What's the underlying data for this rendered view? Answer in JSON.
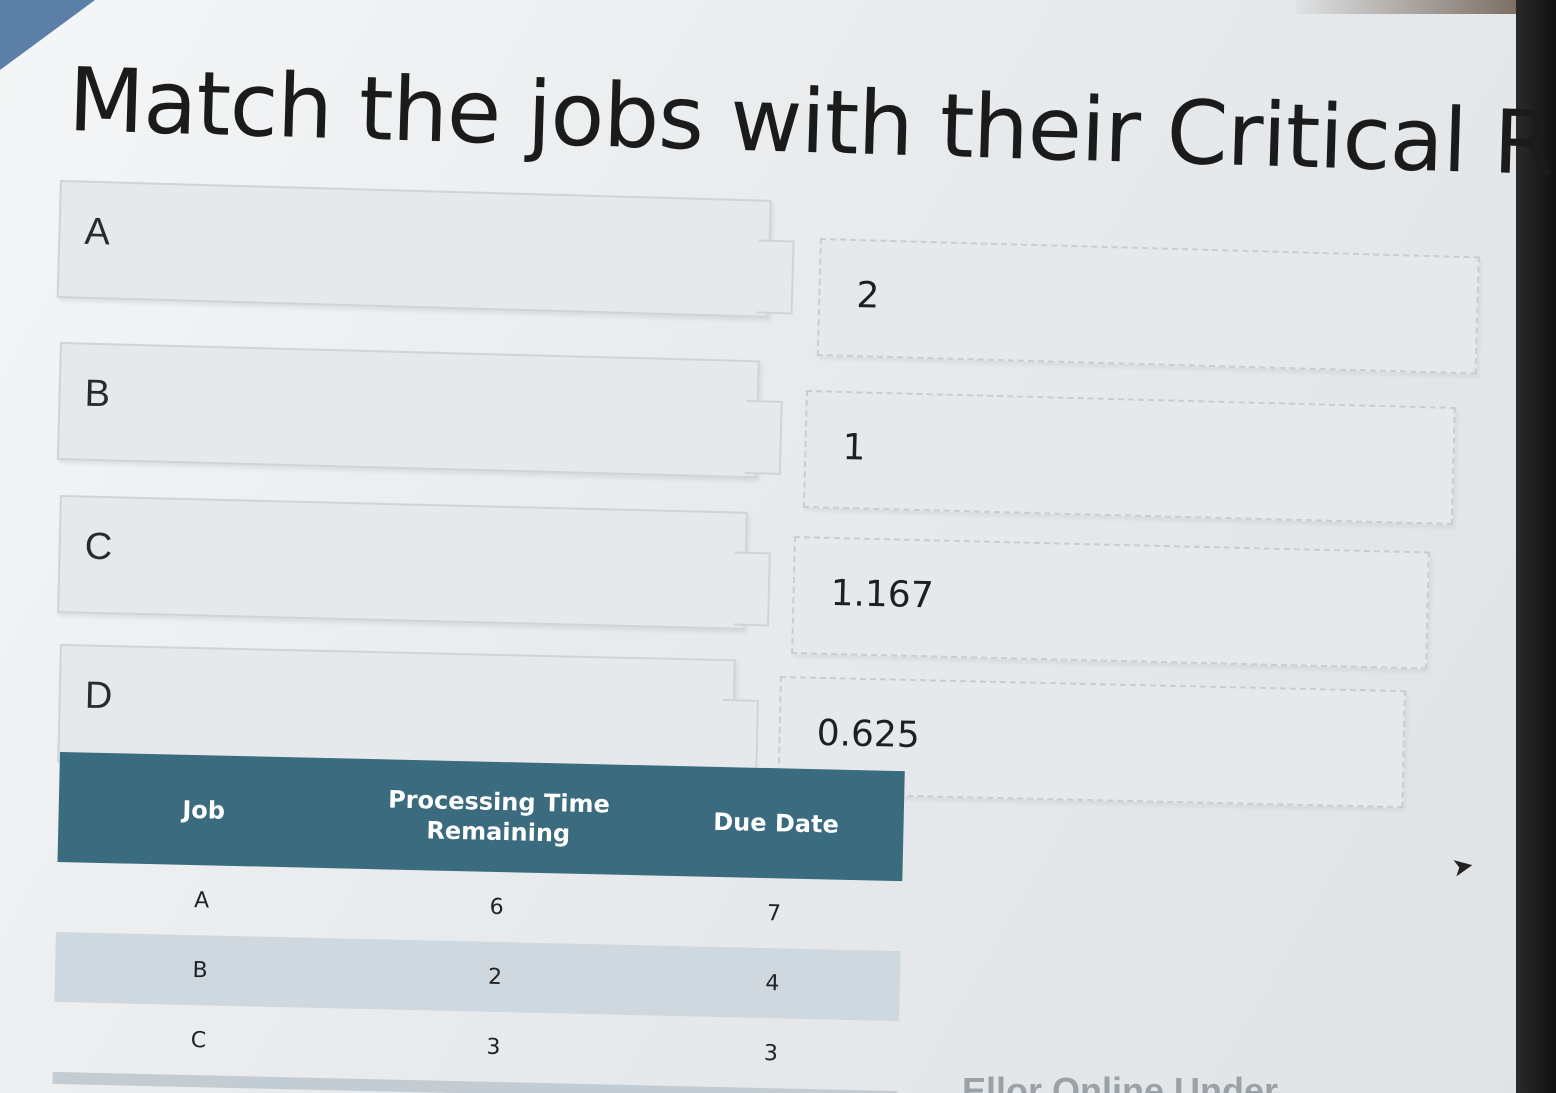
{
  "slide": {
    "title": "Match the jobs with their Critical Ratio"
  },
  "jobs": [
    {
      "label": "A"
    },
    {
      "label": "B"
    },
    {
      "label": "C"
    },
    {
      "label": "D"
    }
  ],
  "ratios": [
    {
      "value": "2"
    },
    {
      "value": "1"
    },
    {
      "value": "1.167"
    },
    {
      "value": "0.625"
    }
  ],
  "table": {
    "headers": [
      "Job",
      "Processing Time Remaining",
      "Due Date"
    ],
    "rows": [
      [
        "A",
        "6",
        "7"
      ],
      [
        "B",
        "2",
        "4"
      ],
      [
        "C",
        "3",
        "3"
      ]
    ]
  },
  "footer": {
    "text": "Ellor Online Under..."
  },
  "icons": {
    "cursor": "mouse-pointer-icon"
  },
  "colors": {
    "table_header": "#3a6b7e",
    "accent": "#5c7fa8"
  }
}
